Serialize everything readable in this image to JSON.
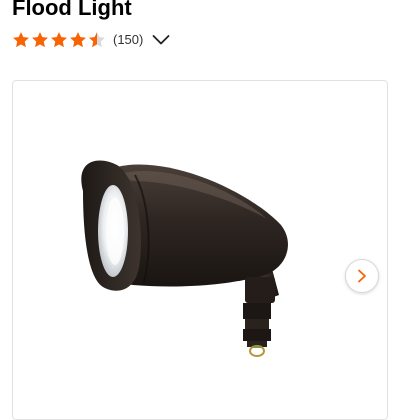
{
  "product": {
    "title": "Flood Light",
    "rating": {
      "value": 4.5,
      "max": 5,
      "count_label": "(150)",
      "star_color": "#f96302",
      "empty_star_color": "#d9d9d9"
    }
  },
  "gallery": {
    "next_icon": "chevron-right-icon",
    "next_color": "#f96302",
    "border_color": "#e2e2e2"
  },
  "icons": {
    "star": "star-icon",
    "expand": "chevron-down-icon"
  }
}
